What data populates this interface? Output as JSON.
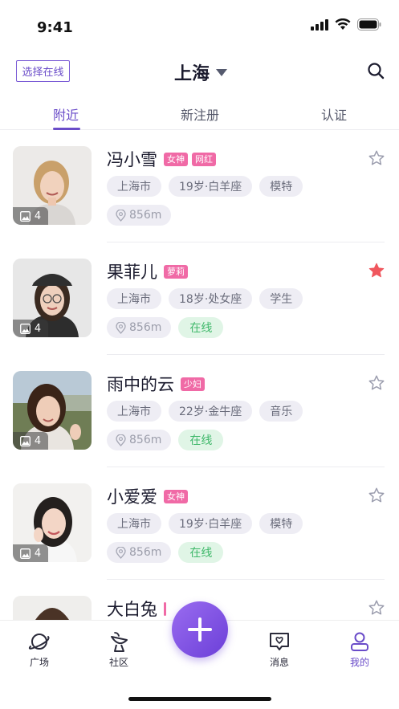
{
  "status_bar": {
    "time": "9:41"
  },
  "header": {
    "online_filter_label": "选择在线",
    "city": "上海"
  },
  "tabs": [
    {
      "label": "附近",
      "active": true
    },
    {
      "label": "新注册",
      "active": false
    },
    {
      "label": "认证",
      "active": false
    }
  ],
  "profiles": [
    {
      "name": "冯小雪",
      "tags": [
        "女神",
        "网红"
      ],
      "city": "上海市",
      "age_sign": "19岁·白羊座",
      "job": "模特",
      "distance": "856m",
      "online": null,
      "photos": "4",
      "favorited": false
    },
    {
      "name": "果菲儿",
      "tags": [
        "萝莉"
      ],
      "city": "上海市",
      "age_sign": "18岁·处女座",
      "job": "学生",
      "distance": "856m",
      "online": "在线",
      "photos": "4",
      "favorited": true
    },
    {
      "name": "雨中的云",
      "tags": [
        "少妇"
      ],
      "city": "上海市",
      "age_sign": "22岁·金牛座",
      "job": "音乐",
      "distance": "856m",
      "online": "在线",
      "photos": "4",
      "favorited": false
    },
    {
      "name": "小爱爱",
      "tags": [
        "女神"
      ],
      "city": "上海市",
      "age_sign": "19岁·白羊座",
      "job": "模特",
      "distance": "856m",
      "online": "在线",
      "photos": "4",
      "favorited": false
    },
    {
      "name": "大白兔",
      "tags": [],
      "city": "",
      "age_sign": "",
      "job": "",
      "distance": "",
      "online": null,
      "photos": "",
      "favorited": false
    }
  ],
  "tabbar": {
    "plaza": "广场",
    "community": "社区",
    "messages": "消息",
    "mine": "我的"
  },
  "colors": {
    "accent": "#6a4cc9",
    "tag_pink": "#f06aa6",
    "online_green": "#3fb86a",
    "star_fav": "#f0575e"
  }
}
